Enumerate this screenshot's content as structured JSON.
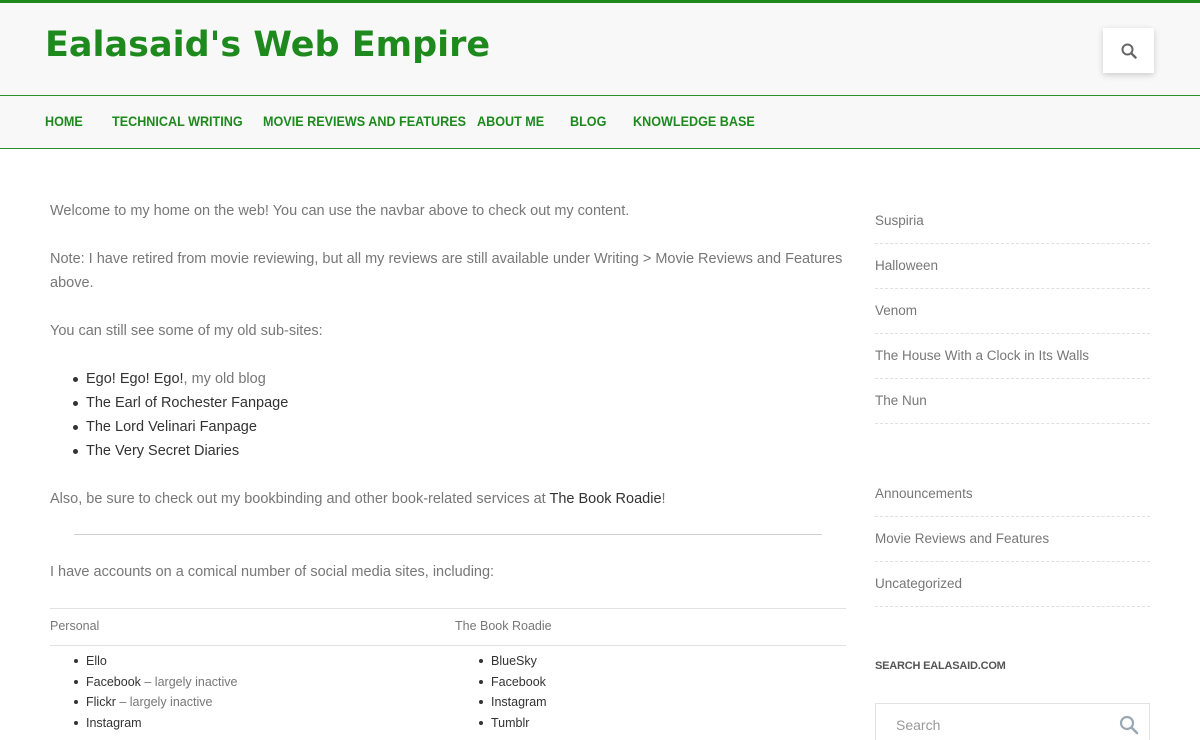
{
  "site": {
    "title": "Ealasaid's Web Empire",
    "accent": "#1e8a1e"
  },
  "nav": {
    "items": [
      "Home",
      "Technical Writing",
      "Movie Reviews and Features",
      "About Me",
      "Blog",
      "Knowledge Base"
    ]
  },
  "content": {
    "welcome": "Welcome to my home on the web! You can use the navbar above to check out my content.",
    "note": "Note: I have retired from movie reviewing, but all my reviews are still available under Writing > Movie Reviews and Features above.",
    "subsites_intro": "You can still see some of my old sub-sites:",
    "subsites": [
      {
        "label": "Ego! Ego! Ego!",
        "suffix": ", my old blog"
      },
      {
        "label": "The Earl of Rochester Fanpage",
        "suffix": ""
      },
      {
        "label": "The Lord Velinari Fanpage",
        "suffix": ""
      },
      {
        "label": "The Very Secret Diaries",
        "suffix": ""
      }
    ],
    "bookroadie_prefix": "Also, be sure to check out my bookbinding and other book-related services at ",
    "bookroadie_link": "The Book Roadie",
    "bookroadie_suffix": "!",
    "social_intro": "I have accounts on a comical number of social media sites, including:",
    "table": {
      "headers": [
        "Personal",
        "The Book Roadie"
      ],
      "personal": [
        {
          "label": "Ello",
          "note": ""
        },
        {
          "label": "Facebook",
          "note": " – largely inactive"
        },
        {
          "label": "Flickr",
          "note": " – largely inactive"
        },
        {
          "label": "Instagram",
          "note": ""
        }
      ],
      "bookroadie": [
        {
          "label": "BlueSky"
        },
        {
          "label": "Facebook"
        },
        {
          "label": "Instagram"
        },
        {
          "label": "Tumblr"
        }
      ]
    }
  },
  "sidebar": {
    "recent_posts": [
      "Suspiria",
      "Halloween",
      "Venom",
      "The House With a Clock in Its Walls",
      "The Nun"
    ],
    "categories": [
      "Announcements",
      "Movie Reviews and Features",
      "Uncategorized"
    ],
    "search_title": "Search Ealasaid.com",
    "search_placeholder": "Search"
  },
  "icons": {
    "header_search": "search-icon",
    "sidebar_search": "search-icon"
  }
}
